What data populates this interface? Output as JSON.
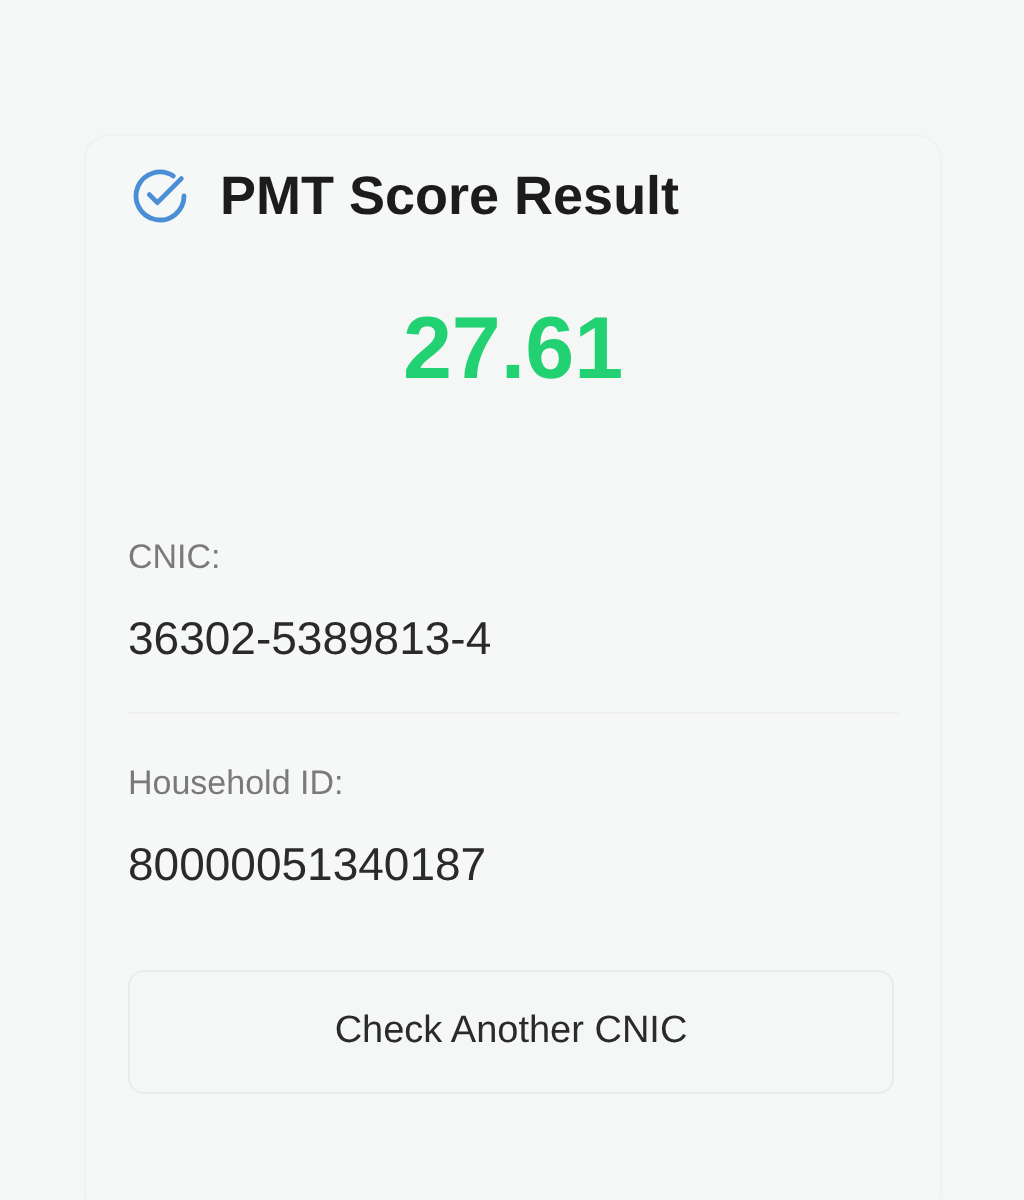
{
  "card": {
    "title": "PMT Score Result",
    "score": "27.61",
    "fields": [
      {
        "label": "CNIC:",
        "value": "36302-5389813-4"
      },
      {
        "label": "Household ID:",
        "value": "80000051340187"
      }
    ],
    "button": "Check Another CNIC"
  }
}
